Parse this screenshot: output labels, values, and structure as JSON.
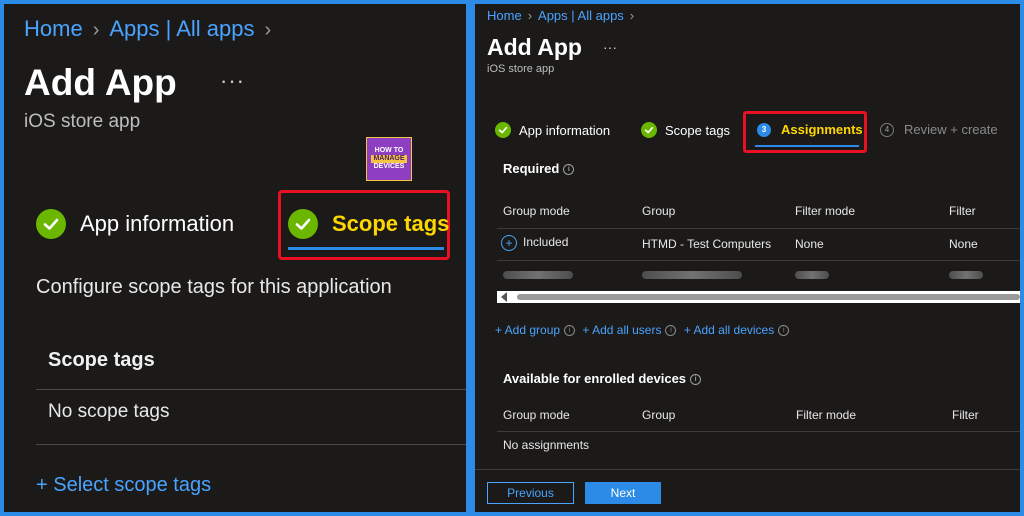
{
  "left": {
    "breadcrumb": {
      "home": "Home",
      "apps": "Apps | All apps"
    },
    "title": "Add App",
    "more": "···",
    "subtitle": "iOS store app",
    "logo": {
      "line1": "HOW TO",
      "line2": "MANAGE",
      "line3": "DEVICES"
    },
    "steps": {
      "app_information": "App information",
      "scope_tags": "Scope tags"
    },
    "configure_text": "Configure scope tags for this application",
    "table_header": "Scope tags",
    "table_empty": "No scope tags",
    "select_link": "+ Select scope tags"
  },
  "right": {
    "breadcrumb": {
      "home": "Home",
      "apps": "Apps | All apps"
    },
    "title": "Add App",
    "more": "···",
    "subtitle": "iOS store app",
    "steps": {
      "app_information": "App information",
      "scope_tags": "Scope tags",
      "assignments_num": "3",
      "assignments": "Assignments",
      "review_num": "4",
      "review": "Review + create"
    },
    "required": {
      "heading": "Required",
      "columns": [
        "Group mode",
        "Group",
        "Filter mode",
        "Filter"
      ],
      "row1": {
        "mode": "Included",
        "group": "HTMD - Test Computers",
        "filter_mode": "None",
        "filter": "None"
      }
    },
    "actions": {
      "add_group": "+ Add group",
      "add_all_users": "+ Add all users",
      "add_all_devices": "+ Add all devices"
    },
    "available": {
      "heading": "Available for enrolled devices",
      "columns": [
        "Group mode",
        "Group",
        "Filter mode",
        "Filter"
      ],
      "empty": "No assignments"
    },
    "buttons": {
      "previous": "Previous",
      "next": "Next"
    }
  },
  "colors": {
    "accent": "#2b8be6",
    "highlight": "#e81123",
    "active_text": "#ffd700",
    "success": "#6bb700",
    "link": "#4aa3ff"
  }
}
